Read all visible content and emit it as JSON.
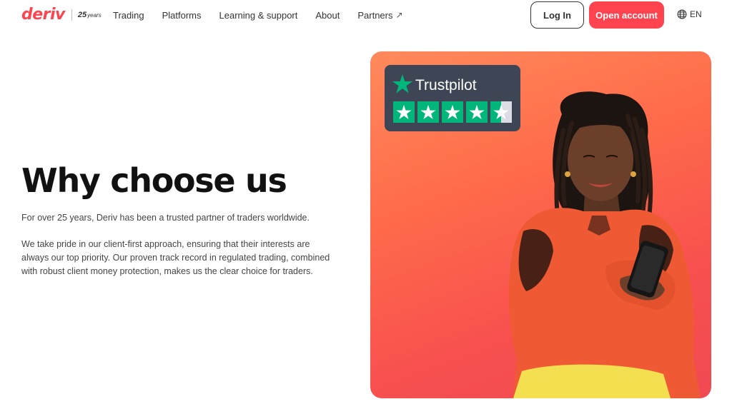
{
  "header": {
    "logo": {
      "wordmark": "deriv",
      "years_number": "25",
      "years_text": "years"
    },
    "nav": [
      {
        "label": "Trading",
        "icon": null
      },
      {
        "label": "Platforms",
        "icon": null
      },
      {
        "label": "Learning & support",
        "icon": null
      },
      {
        "label": "About",
        "icon": null
      },
      {
        "label": "Partners",
        "icon": "arrow-up-right-icon"
      }
    ],
    "login_label": "Log In",
    "open_account_label": "Open account",
    "language": {
      "icon": "globe-icon",
      "code": "EN"
    }
  },
  "main": {
    "title": "Why choose us",
    "paragraph_1": "For over 25 years, Deriv has been a trusted partner of traders worldwide.",
    "paragraph_2": "We take pride in our client-first approach, ensuring that their interests are always our top priority. Our proven track record in regulated trading, combined with robust client money protection, makes us the clear choice for traders."
  },
  "hero": {
    "trustpilot": {
      "name": "Trustpilot",
      "rating_stars": 4.5,
      "max_stars": 5
    }
  },
  "colors": {
    "brand_red": "#ff444f",
    "trustpilot_green": "#00b67a",
    "trustpilot_card": "#3e4655"
  }
}
